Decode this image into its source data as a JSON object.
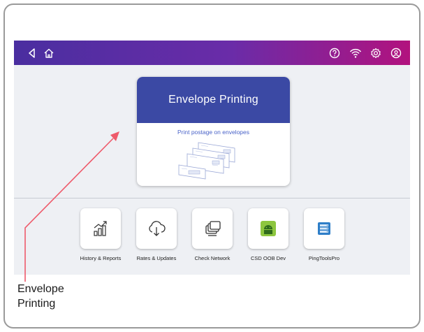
{
  "hero": {
    "title": "Envelope Printing",
    "subtitle": "Print postage on envelopes"
  },
  "apps": [
    {
      "label": "History & Reports",
      "icon": "chart-up-icon"
    },
    {
      "label": "Rates & Updates",
      "icon": "cloud-download-icon"
    },
    {
      "label": "Check Network",
      "icon": "network-icon"
    },
    {
      "label": "CSD OOB Dev",
      "icon": "android-icon"
    },
    {
      "label": "PingToolsPro",
      "icon": "server-icon"
    }
  ],
  "callout": {
    "line1": "Envelope",
    "line2": "Printing"
  },
  "colors": {
    "accent": "#3b49a4",
    "arrow": "#ee5a6a",
    "topbar_start": "#4a2ea0",
    "topbar_end": "#b2127e",
    "android": "#8dc63f",
    "server": "#2e7ec8"
  }
}
